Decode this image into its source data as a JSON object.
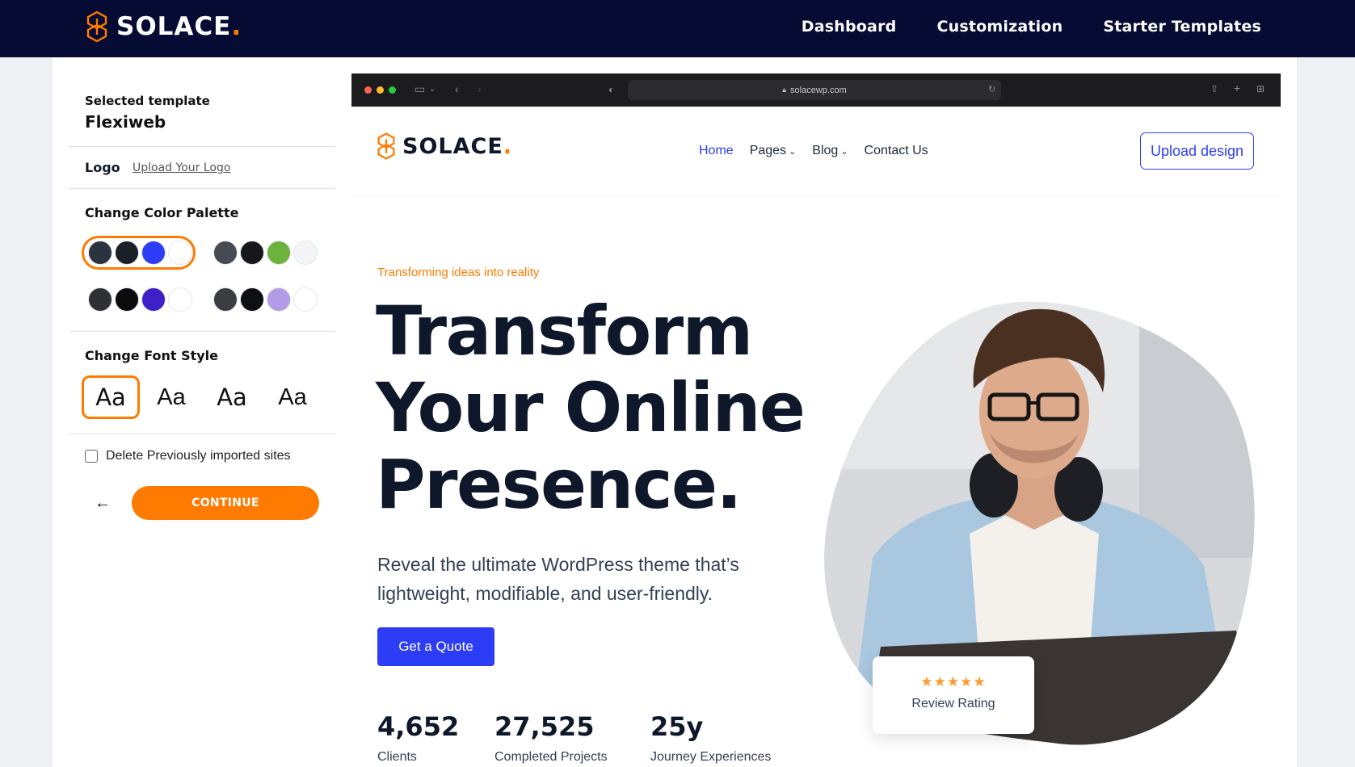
{
  "topbar": {
    "brand": "SOLACE",
    "brand_dot": ".",
    "nav": [
      "Dashboard",
      "Customization",
      "Starter Templates"
    ]
  },
  "sidebar": {
    "selected_label": "Selected template",
    "selected_value": "Flexiweb",
    "logo_label": "Logo",
    "upload_logo": "Upload Your Logo",
    "palette_title": "Change Color Palette",
    "palettes": [
      {
        "colors": [
          "#2c3340",
          "#1b1f27",
          "#2d3df5",
          "#ffffff"
        ],
        "selected": true
      },
      {
        "colors": [
          "#464a52",
          "#15171c",
          "#6cb33e",
          "#f4f5f6"
        ],
        "selected": false
      },
      {
        "colors": [
          "#2f3033",
          "#0b0b0e",
          "#3d20c8",
          "#ffffff"
        ],
        "selected": false
      },
      {
        "colors": [
          "#3b3d42",
          "#0e0f13",
          "#b49be8",
          "#ffffff"
        ],
        "selected": false
      }
    ],
    "font_title": "Change Font Style",
    "fonts": [
      "Aa",
      "Aa",
      "Aa",
      "Aa"
    ],
    "delete_label": "Delete Previously imported sites",
    "back_symbol": "←",
    "continue_label": "CONTINUE"
  },
  "browser": {
    "url": "solacewp.com",
    "site_brand": "SOLACE",
    "site_brand_dot": ".",
    "nav": {
      "home": "Home",
      "pages": "Pages",
      "blog": "Blog",
      "contact": "Contact Us"
    },
    "upload_design": "Upload design",
    "tagline": "Transforming ideas into reality",
    "hero_title": "Transform Your Online Presence.",
    "hero_desc": "Reveal the ultimate WordPress theme that’s lightweight, modifiable, and user-friendly.",
    "quote_button": "Get a Quote",
    "stats": [
      {
        "value": "4,652",
        "label": "Clients"
      },
      {
        "value": "27,525",
        "label": "Completed Projects"
      },
      {
        "value": "25y",
        "label": "Journey Experiences"
      }
    ],
    "review": {
      "stars": "★★★★★",
      "label": "Review Rating"
    }
  },
  "colors": {
    "accent": "#ff7a00",
    "primary": "#2d3df5",
    "topbar_bg": "#050b33"
  }
}
